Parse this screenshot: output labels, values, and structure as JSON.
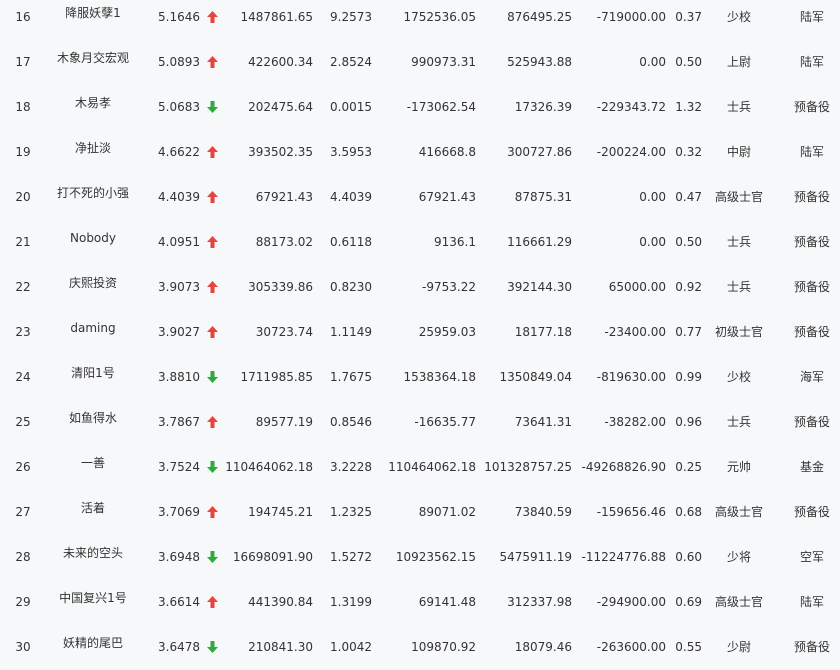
{
  "colors": {
    "up": "#e8443e",
    "down": "#2eaa3c"
  },
  "rows": [
    {
      "rank": "16",
      "name": "降服妖孽1",
      "ret": "5.1646",
      "trend": "up",
      "v1": "1487861.65",
      "v2": "9.2573",
      "v3": "1752536.05",
      "v4": "876495.25",
      "v5": "-719000.00",
      "v6": "0.37",
      "title": "少校",
      "army": "陆军"
    },
    {
      "rank": "17",
      "name": "木象月交宏观",
      "ret": "5.0893",
      "trend": "up",
      "v1": "422600.34",
      "v2": "2.8524",
      "v3": "990973.31",
      "v4": "525943.88",
      "v5": "0.00",
      "v6": "0.50",
      "title": "上尉",
      "army": "陆军"
    },
    {
      "rank": "18",
      "name": "木易孝",
      "ret": "5.0683",
      "trend": "down",
      "v1": "202475.64",
      "v2": "0.0015",
      "v3": "-173062.54",
      "v4": "17326.39",
      "v5": "-229343.72",
      "v6": "1.32",
      "title": "士兵",
      "army": "预备役"
    },
    {
      "rank": "19",
      "name": "净扯淡",
      "ret": "4.6622",
      "trend": "up",
      "v1": "393502.35",
      "v2": "3.5953",
      "v3": "416668.8",
      "v4": "300727.86",
      "v5": "-200224.00",
      "v6": "0.32",
      "title": "中尉",
      "army": "陆军"
    },
    {
      "rank": "20",
      "name": "打不死的小强",
      "ret": "4.4039",
      "trend": "up",
      "v1": "67921.43",
      "v2": "4.4039",
      "v3": "67921.43",
      "v4": "87875.31",
      "v5": "0.00",
      "v6": "0.47",
      "title": "高级士官",
      "army": "预备役"
    },
    {
      "rank": "21",
      "name": "Nobody",
      "ret": "4.0951",
      "trend": "up",
      "v1": "88173.02",
      "v2": "0.6118",
      "v3": "9136.1",
      "v4": "116661.29",
      "v5": "0.00",
      "v6": "0.50",
      "title": "士兵",
      "army": "预备役"
    },
    {
      "rank": "22",
      "name": "庆熙投资",
      "ret": "3.9073",
      "trend": "up",
      "v1": "305339.86",
      "v2": "0.8230",
      "v3": "-9753.22",
      "v4": "392144.30",
      "v5": "65000.00",
      "v6": "0.92",
      "title": "士兵",
      "army": "预备役"
    },
    {
      "rank": "23",
      "name": "daming",
      "ret": "3.9027",
      "trend": "up",
      "v1": "30723.74",
      "v2": "1.1149",
      "v3": "25959.03",
      "v4": "18177.18",
      "v5": "-23400.00",
      "v6": "0.77",
      "title": "初级士官",
      "army": "预备役"
    },
    {
      "rank": "24",
      "name": "清阳1号",
      "ret": "3.8810",
      "trend": "down",
      "v1": "1711985.85",
      "v2": "1.7675",
      "v3": "1538364.18",
      "v4": "1350849.04",
      "v5": "-819630.00",
      "v6": "0.99",
      "title": "少校",
      "army": "海军"
    },
    {
      "rank": "25",
      "name": "如鱼得水",
      "ret": "3.7867",
      "trend": "up",
      "v1": "89577.19",
      "v2": "0.8546",
      "v3": "-16635.77",
      "v4": "73641.31",
      "v5": "-38282.00",
      "v6": "0.96",
      "title": "士兵",
      "army": "预备役"
    },
    {
      "rank": "26",
      "name": "一善",
      "ret": "3.7524",
      "trend": "down",
      "v1": "110464062.18",
      "v2": "3.2228",
      "v3": "110464062.18",
      "v4": "101328757.25",
      "v5": "-49268826.90",
      "v6": "0.25",
      "title": "元帅",
      "army": "基金"
    },
    {
      "rank": "27",
      "name": "活着",
      "ret": "3.7069",
      "trend": "up",
      "v1": "194745.21",
      "v2": "1.2325",
      "v3": "89071.02",
      "v4": "73840.59",
      "v5": "-159656.46",
      "v6": "0.68",
      "title": "高级士官",
      "army": "预备役"
    },
    {
      "rank": "28",
      "name": "未来的空头",
      "ret": "3.6948",
      "trend": "down",
      "v1": "16698091.90",
      "v2": "1.5272",
      "v3": "10923562.15",
      "v4": "5475911.19",
      "v5": "-11224776.88",
      "v6": "0.60",
      "title": "少将",
      "army": "空军"
    },
    {
      "rank": "29",
      "name": "中国复兴1号",
      "ret": "3.6614",
      "trend": "up",
      "v1": "441390.84",
      "v2": "1.3199",
      "v3": "69141.48",
      "v4": "312337.98",
      "v5": "-294900.00",
      "v6": "0.69",
      "title": "高级士官",
      "army": "陆军"
    },
    {
      "rank": "30",
      "name": "妖精的尾巴",
      "ret": "3.6478",
      "trend": "down",
      "v1": "210841.30",
      "v2": "1.0042",
      "v3": "109870.92",
      "v4": "18079.46",
      "v5": "-263600.00",
      "v6": "0.55",
      "title": "少尉",
      "army": "预备役"
    }
  ]
}
